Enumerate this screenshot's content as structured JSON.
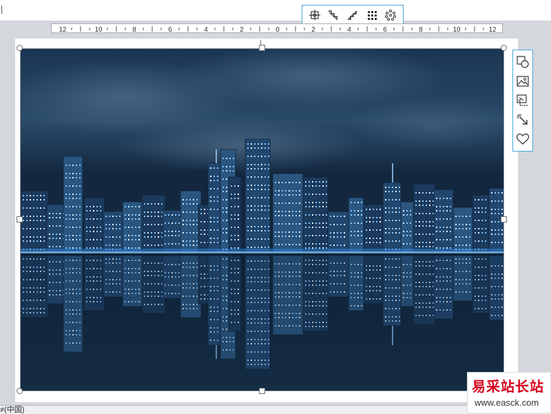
{
  "picture_toolbar": {
    "tools": [
      {
        "icon": "crop-center-icon"
      },
      {
        "icon": "step-down-icon"
      },
      {
        "icon": "step-up-icon"
      },
      {
        "icon": "grid-dots-icon"
      },
      {
        "icon": "scatter-dots-icon"
      }
    ],
    "accent_color": "#4aa6d8"
  },
  "ruler": {
    "labels": [
      "12",
      "10",
      "8",
      "6",
      "4",
      "2",
      "0",
      "2",
      "4",
      "6",
      "8",
      "10",
      "12"
    ]
  },
  "quick_tools": [
    {
      "icon": "shape-style-icon"
    },
    {
      "icon": "picture-icon"
    },
    {
      "icon": "crop-picture-icon"
    },
    {
      "icon": "resize-arrow-icon"
    },
    {
      "icon": "heart-icon"
    }
  ],
  "status_bar": {
    "text": "≠(中国)"
  },
  "watermark": {
    "name": "易采站长站",
    "url": "www.easck.com",
    "color": "#d6001c"
  }
}
